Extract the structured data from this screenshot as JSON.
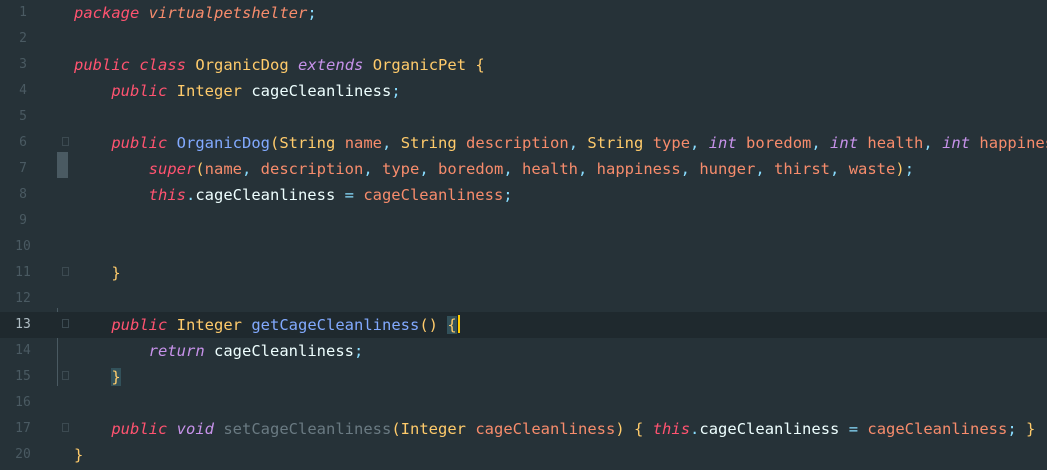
{
  "editor": {
    "current_line_number": "13",
    "colors": {
      "background": "#263238",
      "keyword": "#c792ea",
      "this_super": "#ff5370",
      "type": "#ffcb6b",
      "method": "#82aaff",
      "parameter": "#f78c6c",
      "punctuation": "#89ddff",
      "caret": "#ffcc00"
    },
    "lines": [
      {
        "number": "1",
        "fold": false,
        "tokens": [
          {
            "t": "package",
            "c": "kw2"
          },
          {
            "t": " ",
            "c": "pl"
          },
          {
            "t": "virtualpetshelter",
            "c": "pkg"
          },
          {
            "t": ";",
            "c": "pu"
          }
        ]
      },
      {
        "number": "2",
        "fold": false,
        "tokens": []
      },
      {
        "number": "3",
        "fold": false,
        "tokens": [
          {
            "t": "public",
            "c": "kw2"
          },
          {
            "t": " ",
            "c": "pl"
          },
          {
            "t": "class",
            "c": "kw2"
          },
          {
            "t": " ",
            "c": "pl"
          },
          {
            "t": "OrganicDog",
            "c": "ty"
          },
          {
            "t": " ",
            "c": "pl"
          },
          {
            "t": "extends",
            "c": "kw"
          },
          {
            "t": " ",
            "c": "pl"
          },
          {
            "t": "OrganicPet",
            "c": "ty"
          },
          {
            "t": " ",
            "c": "pl"
          },
          {
            "t": "{",
            "c": "br"
          }
        ]
      },
      {
        "number": "4",
        "fold": false,
        "tokens": [
          {
            "t": "    ",
            "c": "pl"
          },
          {
            "t": "public",
            "c": "kw2"
          },
          {
            "t": " ",
            "c": "pl"
          },
          {
            "t": "Integer",
            "c": "ty"
          },
          {
            "t": " ",
            "c": "pl"
          },
          {
            "t": "cageCleanliness",
            "c": "pl"
          },
          {
            "t": ";",
            "c": "pu"
          }
        ]
      },
      {
        "number": "5",
        "fold": false,
        "tokens": []
      },
      {
        "number": "6",
        "fold": true,
        "tokens": [
          {
            "t": "    ",
            "c": "pl"
          },
          {
            "t": "public",
            "c": "kw2"
          },
          {
            "t": " ",
            "c": "pl"
          },
          {
            "t": "OrganicDog",
            "c": "fn"
          },
          {
            "t": "(",
            "c": "br"
          },
          {
            "t": "String",
            "c": "ty"
          },
          {
            "t": " ",
            "c": "pl"
          },
          {
            "t": "name",
            "c": "pr"
          },
          {
            "t": ", ",
            "c": "pu"
          },
          {
            "t": "String",
            "c": "ty"
          },
          {
            "t": " ",
            "c": "pl"
          },
          {
            "t": "description",
            "c": "pr"
          },
          {
            "t": ", ",
            "c": "pu"
          },
          {
            "t": "String",
            "c": "ty"
          },
          {
            "t": " ",
            "c": "pl"
          },
          {
            "t": "type",
            "c": "pr"
          },
          {
            "t": ", ",
            "c": "pu"
          },
          {
            "t": "int",
            "c": "kw"
          },
          {
            "t": " ",
            "c": "pl"
          },
          {
            "t": "boredom",
            "c": "pr"
          },
          {
            "t": ", ",
            "c": "pu"
          },
          {
            "t": "int",
            "c": "kw"
          },
          {
            "t": " ",
            "c": "pl"
          },
          {
            "t": "health",
            "c": "pr"
          },
          {
            "t": ", ",
            "c": "pu"
          },
          {
            "t": "int",
            "c": "kw"
          },
          {
            "t": " ",
            "c": "pl"
          },
          {
            "t": "happiness",
            "c": "pr"
          },
          {
            "t": ",",
            "c": "pu"
          }
        ]
      },
      {
        "number": "7",
        "fold": false,
        "tokens": [
          {
            "t": "        ",
            "c": "pl"
          },
          {
            "t": "super",
            "c": "kw2"
          },
          {
            "t": "(",
            "c": "br"
          },
          {
            "t": "name",
            "c": "pr"
          },
          {
            "t": ", ",
            "c": "pu"
          },
          {
            "t": "description",
            "c": "pr"
          },
          {
            "t": ", ",
            "c": "pu"
          },
          {
            "t": "type",
            "c": "pr"
          },
          {
            "t": ", ",
            "c": "pu"
          },
          {
            "t": "boredom",
            "c": "pr"
          },
          {
            "t": ", ",
            "c": "pu"
          },
          {
            "t": "health",
            "c": "pr"
          },
          {
            "t": ", ",
            "c": "pu"
          },
          {
            "t": "happiness",
            "c": "pr"
          },
          {
            "t": ", ",
            "c": "pu"
          },
          {
            "t": "hunger",
            "c": "pr"
          },
          {
            "t": ", ",
            "c": "pu"
          },
          {
            "t": "thirst",
            "c": "pr"
          },
          {
            "t": ", ",
            "c": "pu"
          },
          {
            "t": "waste",
            "c": "pr"
          },
          {
            "t": ")",
            "c": "br"
          },
          {
            "t": ";",
            "c": "pu"
          }
        ]
      },
      {
        "number": "8",
        "fold": false,
        "tokens": [
          {
            "t": "        ",
            "c": "pl"
          },
          {
            "t": "this",
            "c": "kw2"
          },
          {
            "t": ".",
            "c": "pu"
          },
          {
            "t": "cageCleanliness",
            "c": "pl"
          },
          {
            "t": " = ",
            "c": "pu"
          },
          {
            "t": "cageCleanliness",
            "c": "pr"
          },
          {
            "t": ";",
            "c": "pu"
          }
        ]
      },
      {
        "number": "9",
        "fold": false,
        "tokens": []
      },
      {
        "number": "10",
        "fold": false,
        "tokens": []
      },
      {
        "number": "11",
        "fold": true,
        "tokens": [
          {
            "t": "    ",
            "c": "pl"
          },
          {
            "t": "}",
            "c": "br"
          }
        ]
      },
      {
        "number": "12",
        "fold": false,
        "tokens": []
      },
      {
        "number": "13",
        "fold": true,
        "current": true,
        "tokens": [
          {
            "t": "    ",
            "c": "pl"
          },
          {
            "t": "public",
            "c": "kw2"
          },
          {
            "t": " ",
            "c": "pl"
          },
          {
            "t": "Integer",
            "c": "ty"
          },
          {
            "t": " ",
            "c": "pl"
          },
          {
            "t": "getCageCleanliness",
            "c": "fn"
          },
          {
            "t": "()",
            "c": "br"
          },
          {
            "t": " ",
            "c": "pl"
          },
          {
            "t": "{",
            "c": "br-hl"
          }
        ]
      },
      {
        "number": "14",
        "fold": false,
        "tokens": [
          {
            "t": "        ",
            "c": "pl"
          },
          {
            "t": "return",
            "c": "kw"
          },
          {
            "t": " ",
            "c": "pl"
          },
          {
            "t": "cageCleanliness",
            "c": "pl"
          },
          {
            "t": ";",
            "c": "pu"
          }
        ]
      },
      {
        "number": "15",
        "fold": true,
        "tokens": [
          {
            "t": "    ",
            "c": "pl"
          },
          {
            "t": "}",
            "c": "br-hl"
          }
        ]
      },
      {
        "number": "16",
        "fold": false,
        "tokens": []
      },
      {
        "number": "17",
        "fold": true,
        "tokens": [
          {
            "t": "    ",
            "c": "pl"
          },
          {
            "t": "public",
            "c": "kw2"
          },
          {
            "t": " ",
            "c": "pl"
          },
          {
            "t": "void",
            "c": "kw"
          },
          {
            "t": " ",
            "c": "pl"
          },
          {
            "t": "setCageCleanliness",
            "c": "fn-dim"
          },
          {
            "t": "(",
            "c": "br"
          },
          {
            "t": "Integer",
            "c": "ty"
          },
          {
            "t": " ",
            "c": "pl"
          },
          {
            "t": "cageCleanliness",
            "c": "pr"
          },
          {
            "t": ")",
            "c": "br"
          },
          {
            "t": " ",
            "c": "pl"
          },
          {
            "t": "{",
            "c": "br"
          },
          {
            "t": " ",
            "c": "pl"
          },
          {
            "t": "this",
            "c": "kw2"
          },
          {
            "t": ".",
            "c": "pu"
          },
          {
            "t": "cageCleanliness",
            "c": "pl"
          },
          {
            "t": " = ",
            "c": "pu"
          },
          {
            "t": "cageCleanliness",
            "c": "pr"
          },
          {
            "t": ";",
            "c": "pu"
          },
          {
            "t": " ",
            "c": "pl"
          },
          {
            "t": "}",
            "c": "br"
          }
        ]
      },
      {
        "number": "20",
        "fold": false,
        "tokens": [
          {
            "t": "}",
            "c": "br"
          }
        ]
      }
    ]
  }
}
